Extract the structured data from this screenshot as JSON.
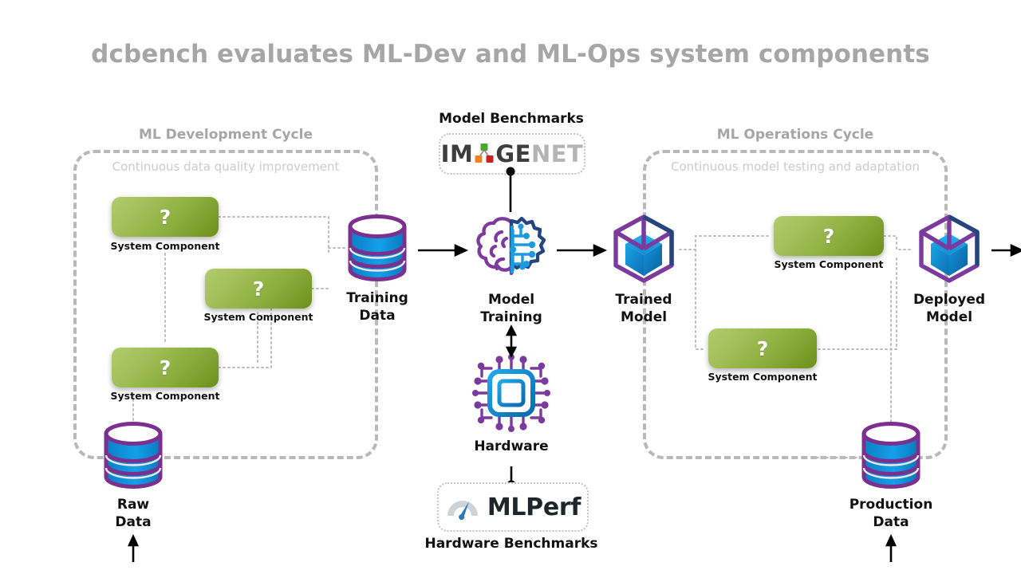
{
  "title": "dcbench evaluates ML-Dev and ML-Ops system components",
  "colors": {
    "title_gray": "#a6a6a6",
    "group_border": "#b9b9b9",
    "sub_gray": "#cccccc",
    "chip_green_dark": "#6d8f1b",
    "chip_green_light": "#b2cc6e",
    "db_purple": "#7b2f8f",
    "db_blue": "#0b8ed8",
    "cube_purple": "#7b3a9e",
    "cube_blue": "#1b9ae0",
    "arrow_black": "#000000",
    "dotted_gray": "#bdbdbd"
  },
  "cycles": {
    "left": {
      "title": "ML Development Cycle",
      "subtitle": "Continuous data quality improvement"
    },
    "right": {
      "title": "ML Operations Cycle",
      "subtitle": "Continuous model testing and adaptation"
    }
  },
  "nodes": {
    "raw_data": {
      "label": "Raw\nData",
      "icon": "database-icon"
    },
    "training_data": {
      "label": "Training\nData",
      "icon": "database-icon"
    },
    "model_training": {
      "label": "Model\nTraining",
      "icon": "brain-gear-icon"
    },
    "trained_model": {
      "label": "Trained\nModel",
      "icon": "cube-icon"
    },
    "deployed_model": {
      "label": "Deployed\nModel",
      "icon": "cube-icon"
    },
    "production_data": {
      "label": "Production\nData",
      "icon": "database-icon"
    },
    "hardware": {
      "label": "Hardware",
      "icon": "cpu-chip-icon"
    }
  },
  "system_components": [
    {
      "id": "dev-1",
      "mark": "?",
      "caption": "System Component"
    },
    {
      "id": "dev-2",
      "mark": "?",
      "caption": "System Component"
    },
    {
      "id": "dev-3",
      "mark": "?",
      "caption": "System Component"
    },
    {
      "id": "ops-1",
      "mark": "?",
      "caption": "System Component"
    },
    {
      "id": "ops-2",
      "mark": "?",
      "caption": "System Component"
    }
  ],
  "benchmarks": {
    "model": {
      "caption": "Model Benchmarks",
      "logo_name": "imagenet-logo",
      "logo_parts": {
        "im": "IM",
        "ge": "GE",
        "net": "NET"
      }
    },
    "hardware": {
      "caption": "Hardware Benchmarks",
      "logo_name": "mlperf-logo",
      "logo_text": "MLPerf"
    }
  }
}
